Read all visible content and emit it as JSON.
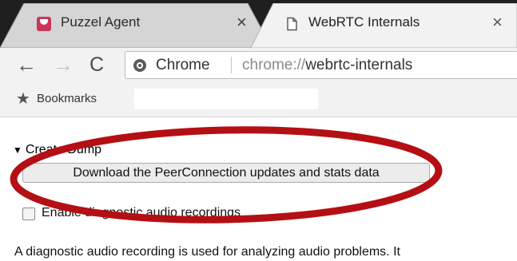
{
  "tabs": [
    {
      "title": "Puzzel Agent",
      "close": "×",
      "icon": "puzzel-logo-icon",
      "active": false
    },
    {
      "title": "WebRTC Internals",
      "close": "×",
      "icon": "page-icon",
      "active": true
    }
  ],
  "toolbar": {
    "back": "←",
    "forward": "→",
    "reload": "C",
    "origin_label": "Chrome",
    "url_scheme": "chrome://",
    "url_rest": "webrtc-internals"
  },
  "bookmarks": {
    "icon": "★",
    "label": "Bookmarks"
  },
  "content": {
    "dump_toggle_arrow": "▼",
    "dump_toggle_label": "Create Dump",
    "download_button": "Download the PeerConnection updates and stats data",
    "checkbox_label": "Enable diagnostic audio recordings",
    "description": "A diagnostic audio recording is used for analyzing audio problems. It"
  },
  "colors": {
    "tabstrip": "#1f1f1f",
    "inactive_tab": "#d5d5d5",
    "toolbar": "#f2f2f2",
    "annotation_ring": "#b40f14"
  }
}
